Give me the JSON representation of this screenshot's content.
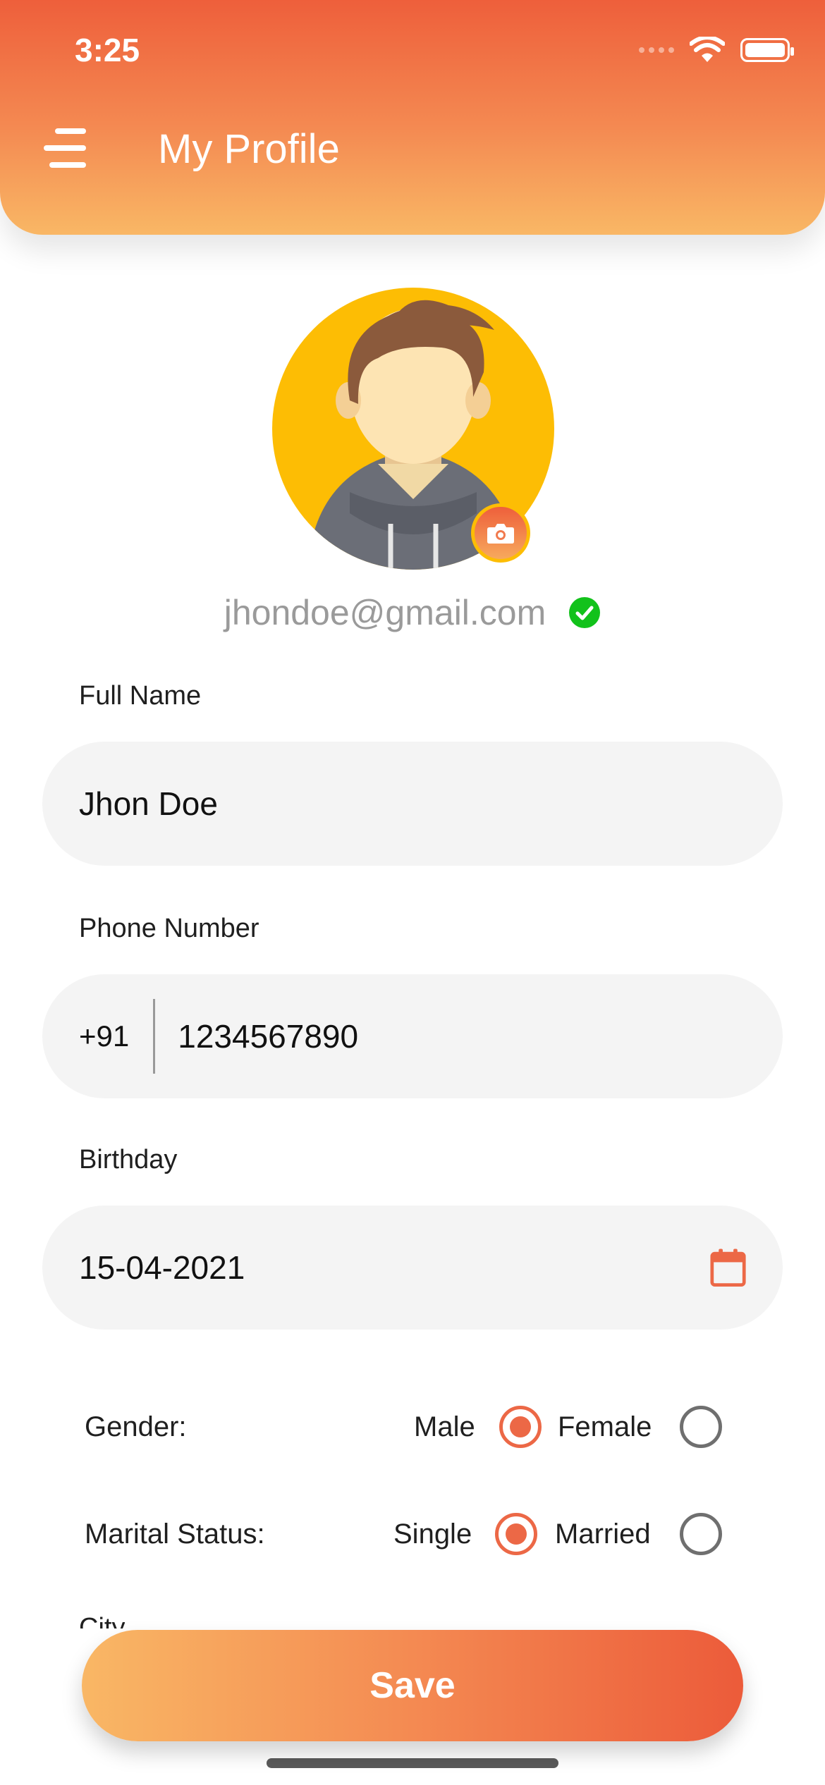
{
  "status_bar": {
    "time": "3:25"
  },
  "header": {
    "title": "My Profile"
  },
  "profile": {
    "email": "jhondoe@gmail.com"
  },
  "form": {
    "full_name": {
      "label": "Full Name",
      "value": "Jhon Doe"
    },
    "phone": {
      "label": "Phone Number",
      "country_code": "+91",
      "value": "1234567890"
    },
    "birthday": {
      "label": "Birthday",
      "value": "15-04-2021"
    },
    "gender": {
      "label": "Gender:",
      "options": [
        "Male",
        "Female"
      ],
      "selected": "Male"
    },
    "marital_status": {
      "label": "Marital Status:",
      "options": [
        "Single",
        "Married"
      ],
      "selected": "Single"
    },
    "city": {
      "label": "City"
    }
  },
  "actions": {
    "save_label": "Save"
  },
  "colors": {
    "accent": "#EC6846",
    "gradient_start": "#EE5F3B",
    "gradient_end": "#F9B765",
    "avatar_bg": "#FDBD04",
    "verified": "#12C21B"
  }
}
